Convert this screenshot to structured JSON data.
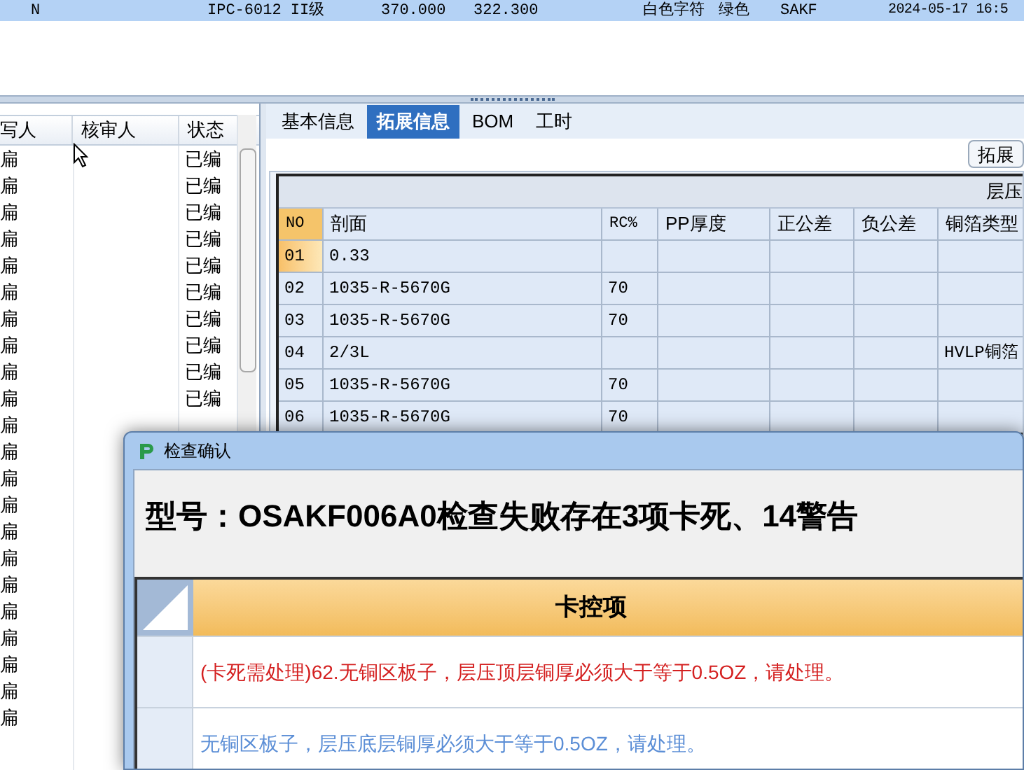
{
  "top_row": {
    "selected": true,
    "cells": [
      "N",
      "IPC-6012 II级",
      "370.000",
      "322.300",
      "白色字符",
      "绿色",
      "SAKF",
      "2024-05-17 16:5"
    ]
  },
  "left_list": {
    "columns": [
      "写人",
      "核审人",
      "状态"
    ],
    "rows": [
      {
        "writer": "扁",
        "status": "已编"
      },
      {
        "writer": "扁",
        "status": "已编"
      },
      {
        "writer": "扁",
        "status": "已编"
      },
      {
        "writer": "扁",
        "status": "已编"
      },
      {
        "writer": "扁",
        "status": "已编"
      },
      {
        "writer": "扁",
        "status": "已编"
      },
      {
        "writer": "扁",
        "status": "已编"
      },
      {
        "writer": "扁",
        "status": "已编"
      },
      {
        "writer": "扁",
        "status": "已编"
      },
      {
        "writer": "扁",
        "status": "已编"
      },
      {
        "writer": "扁"
      },
      {
        "writer": "扁"
      },
      {
        "writer": "扁"
      },
      {
        "writer": "扁"
      },
      {
        "writer": "扁"
      },
      {
        "writer": "扁"
      },
      {
        "writer": "扁"
      },
      {
        "writer": "扁"
      },
      {
        "writer": "扁"
      },
      {
        "writer": "扁"
      },
      {
        "writer": "扁"
      },
      {
        "writer": "扁"
      }
    ]
  },
  "tabs": [
    {
      "label": "基本信息",
      "selected": false
    },
    {
      "label": "拓展信息",
      "selected": true
    },
    {
      "label": "BOM",
      "selected": false
    },
    {
      "label": "工时",
      "selected": false
    }
  ],
  "extend_button": "拓展",
  "stack_grid": {
    "title": "层压",
    "columns": [
      "NO",
      "剖面",
      "RC%",
      "PP厚度",
      "正公差",
      "负公差",
      "铜箔类型"
    ],
    "rows": [
      {
        "selected": true,
        "cells": [
          "01",
          "0.33",
          "",
          "",
          "",
          "",
          ""
        ]
      },
      {
        "selected": false,
        "cells": [
          "02",
          "1035-R-5670G",
          "70",
          "",
          "",
          "",
          ""
        ]
      },
      {
        "selected": false,
        "cells": [
          "03",
          "1035-R-5670G",
          "70",
          "",
          "",
          "",
          ""
        ]
      },
      {
        "selected": false,
        "cells": [
          "04",
          "2/3L",
          "",
          "",
          "",
          "",
          "HVLP铜箔"
        ]
      },
      {
        "selected": false,
        "cells": [
          "05",
          "1035-R-5670G",
          "70",
          "",
          "",
          "",
          ""
        ]
      },
      {
        "selected": false,
        "cells": [
          "06",
          "1035-R-5670G",
          "70",
          "",
          "",
          "",
          ""
        ]
      }
    ]
  },
  "dialog": {
    "title": "检查确认",
    "heading": "型号：OSAKF006A0检查失败存在3项卡死、14警告",
    "column": "卡控项",
    "items": [
      {
        "text": "(卡死需处理)62.无铜区板子，层压顶层铜厚必须大于等于0.5OZ，请处理。",
        "color": "#d42020"
      },
      {
        "text": "无铜区板子，层压底层铜厚必须大于等于0.5OZ，请处理。",
        "color": "#5b8ed6"
      }
    ]
  }
}
